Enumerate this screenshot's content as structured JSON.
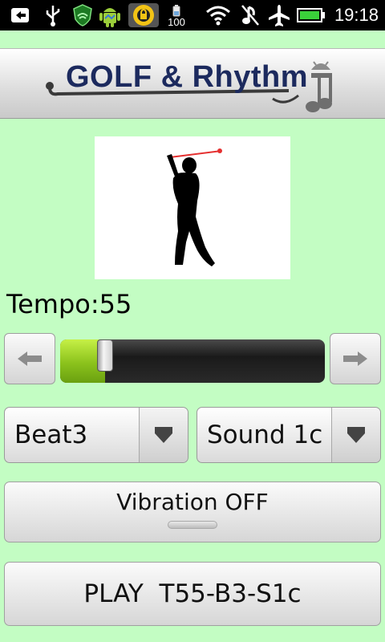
{
  "status_bar": {
    "time": "19:18",
    "battery_level_label": "100",
    "icons": [
      "back-arrow-icon",
      "usb-icon",
      "shield-signal-icon",
      "android-icon",
      "lock-app-icon",
      "battery-widget-icon",
      "wifi-icon",
      "mute-icon",
      "airplane-mode-icon",
      "battery-icon"
    ]
  },
  "header": {
    "title": "GOLF & Rhythm"
  },
  "image": {
    "name": "golfer-silhouette"
  },
  "tempo": {
    "label": "Tempo:55",
    "value": 55,
    "slider_fraction": 0.17
  },
  "beat_spinner": {
    "value": "Beat3"
  },
  "sound_spinner": {
    "value": "Sound 1c"
  },
  "vibration_button": {
    "label": "Vibration OFF",
    "on": false
  },
  "play_button": {
    "label": "PLAY  T55-B3-S1c"
  },
  "colors": {
    "background": "#c3fdc3",
    "title": "#1c2a5e",
    "slider_fill": "#8bc21c",
    "swing_line": "#e53030"
  }
}
